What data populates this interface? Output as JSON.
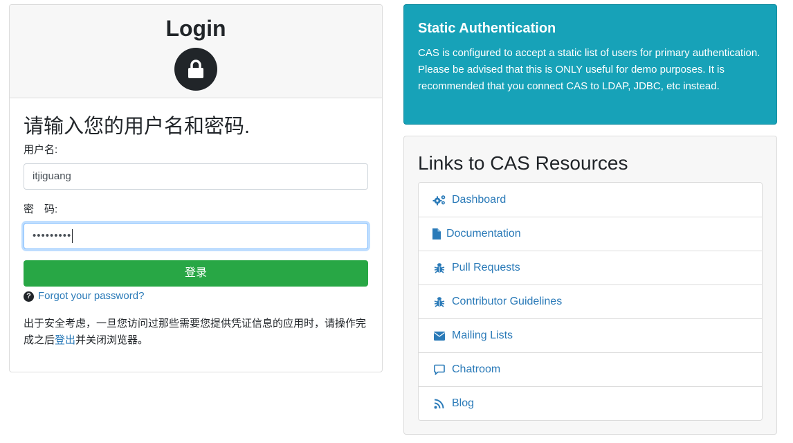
{
  "login": {
    "title": "Login",
    "lock_icon": "lock-icon",
    "prompt": "请输入您的用户名和密码.",
    "username_label": "用户名:",
    "username_value": "itjiguang",
    "password_label": "密　码:",
    "password_mask": "•••••••••",
    "submit_label": "登录",
    "forgot_icon": "question-circle-icon",
    "forgot_label": "Forgot your password?",
    "notice_before": "出于安全考虑，一旦您访问过那些需要您提供凭证信息的应用时，请操作完成之后",
    "notice_link": "登出",
    "notice_after": "并关闭浏览器。"
  },
  "alert": {
    "title": "Static Authentication",
    "body": "CAS is configured to accept a static list of users for primary authentication. Please be advised that this is ONLY useful for demo purposes. It is recommended that you connect CAS to LDAP, JDBC, etc instead."
  },
  "resources": {
    "title": "Links to CAS Resources",
    "items": [
      {
        "label": "Dashboard",
        "icon": "cogs-icon"
      },
      {
        "label": "Documentation",
        "icon": "file-icon"
      },
      {
        "label": "Pull Requests",
        "icon": "bug-icon"
      },
      {
        "label": "Contributor Guidelines",
        "icon": "bug-icon"
      },
      {
        "label": "Mailing Lists",
        "icon": "envelope-icon"
      },
      {
        "label": "Chatroom",
        "icon": "comment-icon"
      },
      {
        "label": "Blog",
        "icon": "rss-icon"
      }
    ]
  },
  "colors": {
    "success": "#28a745",
    "info": "#17a2b8",
    "link": "#2a7ab8"
  }
}
